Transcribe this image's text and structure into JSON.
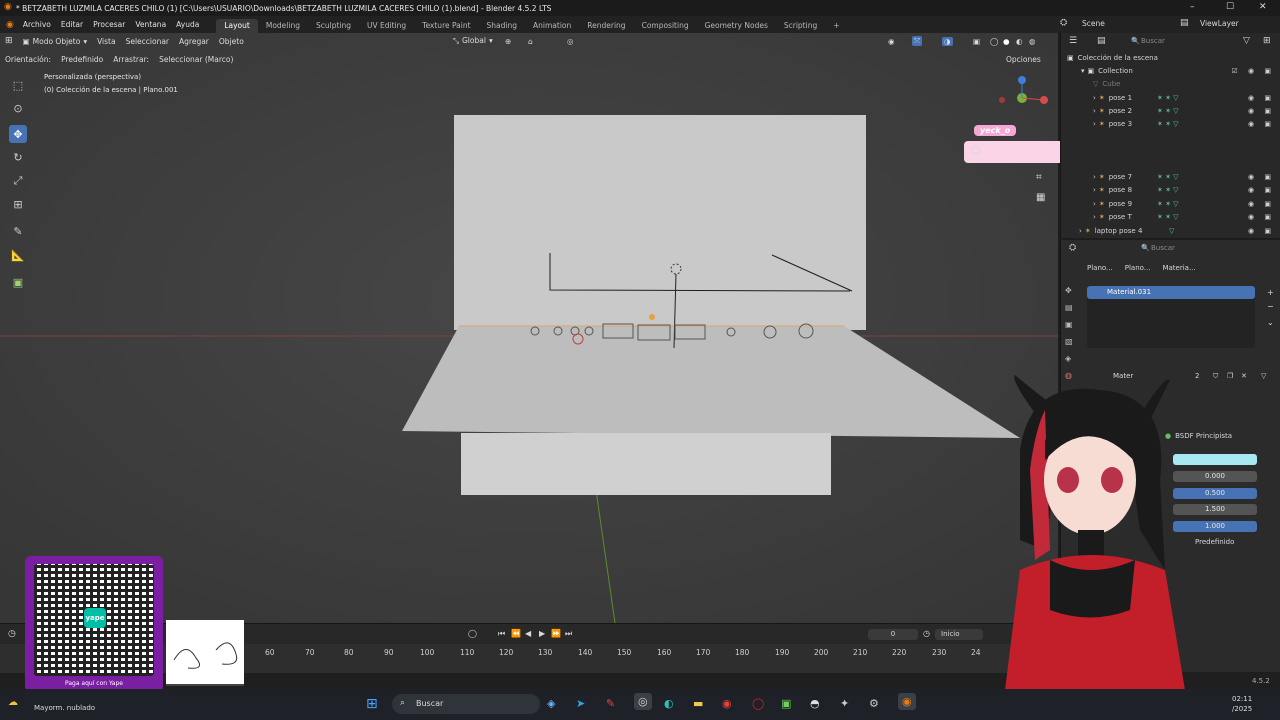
{
  "window": {
    "title": "* BETZABETH LUZMILA CACERES CHILO (1) [C:\\Users\\USUARIO\\Downloads\\BETZABETH LUZMILA CACERES CHILO (1).blend] - Blender 4.5.2 LTS"
  },
  "menu": {
    "items": [
      "Archivo",
      "Editar",
      "Procesar",
      "Ventana",
      "Ayuda"
    ],
    "workspaces": [
      "Layout",
      "Modeling",
      "Sculpting",
      "UV Editing",
      "Texture Paint",
      "Shading",
      "Animation",
      "Rendering",
      "Compositing",
      "Geometry Nodes",
      "Scripting"
    ],
    "active_workspace": "Layout",
    "scene": "Scene",
    "view_layer": "ViewLayer"
  },
  "viewport_header": {
    "mode": "Modo Objeto",
    "menus": [
      "Vista",
      "Seleccionar",
      "Agregar",
      "Objeto"
    ],
    "transform": "Global",
    "orientation_label": "Orientación:",
    "orientation_value": "Predefinido",
    "drag_label": "Arrastrar:",
    "drag_value": "Seleccionar (Marco)",
    "options": "Opciones"
  },
  "viewport_overlay": {
    "view_name": "Personalizada (perspectiva)",
    "collection_info": "(0) Colección de la escena | Plano.001"
  },
  "outliner": {
    "search_placeholder": "Buscar",
    "scene_collection": "Colección de la escena",
    "collection": "Collection",
    "items": [
      "Cube",
      "pose 1",
      "pose 2",
      "pose 3",
      "pose 7",
      "pose 8",
      "pose 9",
      "pose T"
    ],
    "last_item": "laptop pose 4"
  },
  "properties": {
    "search_placeholder": "Buscar",
    "breadcrumb": [
      "Plano...",
      "Plano...",
      "Materia..."
    ],
    "material_slot": "Material.031",
    "material_label": "Mater",
    "user_count": "2",
    "surface": "BSDF Principista",
    "field_values": [
      "0.000",
      "0.500",
      "1.500",
      "1.000"
    ],
    "preset": "Predefinido",
    "base_color": "#a8e8f2"
  },
  "timeline": {
    "current_frame": "0",
    "start_label": "Inicio",
    "ticks": [
      "60",
      "70",
      "80",
      "90",
      "100",
      "110",
      "120",
      "130",
      "140",
      "150",
      "160",
      "170",
      "180",
      "190",
      "200",
      "210",
      "220",
      "230",
      "24"
    ]
  },
  "stream_overlay": {
    "chat_user": "yeck_o",
    "qr_caption": "Paga aquí con Yape",
    "qr_brand": "yape"
  },
  "taskbar": {
    "weather": "Mayorm. nublado",
    "search": "Buscar",
    "time": "02:11",
    "date": "/2025"
  },
  "status": {
    "version": "4.5.2"
  },
  "colors": {
    "accent": "#4772b3",
    "selected_row": "#4772b3",
    "chat_bubble": "#fcd4e8",
    "chat_name_bg": "#f3a8d6",
    "qr_frame": "#7b1fa2"
  }
}
